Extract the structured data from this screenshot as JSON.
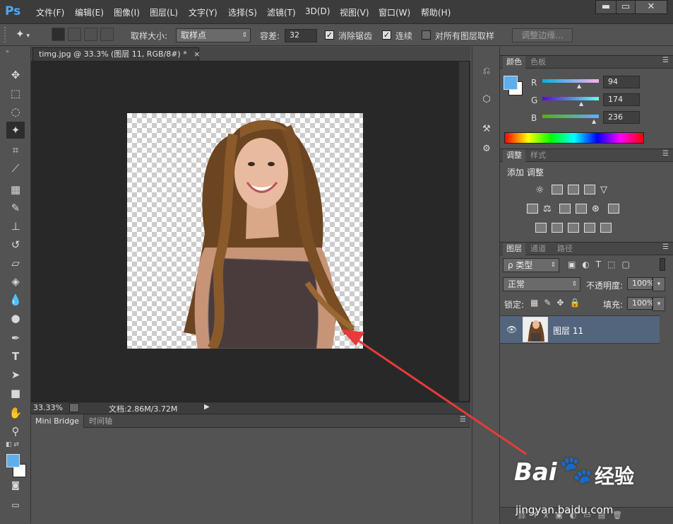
{
  "app": {
    "logo": "Ps"
  },
  "menu": [
    "文件(F)",
    "编辑(E)",
    "图像(I)",
    "图层(L)",
    "文字(Y)",
    "选择(S)",
    "滤镜(T)",
    "3D(D)",
    "视图(V)",
    "窗口(W)",
    "帮助(H)"
  ],
  "window_controls": {
    "minimize": "▬",
    "maximize": "▭",
    "close": "✕"
  },
  "options": {
    "sample_size_label": "取样大小:",
    "sample_size_value": "取样点",
    "tolerance_label": "容差:",
    "tolerance_value": "32",
    "antialias_label": "消除锯齿",
    "antialias_checked": true,
    "contiguous_label": "连续",
    "contiguous_checked": true,
    "all_layers_label": "对所有图层取样",
    "all_layers_checked": false,
    "refine_edge_label": "调整边缘..."
  },
  "document": {
    "tab_title": "timg.jpg @ 33.3% (图层 11, RGB/8#) *",
    "close": "×"
  },
  "status": {
    "zoom": "33.33%",
    "doc_label": "文档:2.86M/3.72M"
  },
  "bridge": {
    "tabs": [
      "Mini Bridge",
      "时间轴"
    ]
  },
  "color_panel": {
    "tabs": [
      "颜色",
      "色板"
    ],
    "r_label": "R",
    "r_value": "94",
    "g_label": "G",
    "g_value": "174",
    "b_label": "B",
    "b_value": "236",
    "fg_color": "#5eaeec",
    "r_frac": 0.37,
    "g_frac": 0.68,
    "b_frac": 0.93
  },
  "adjust_panel": {
    "tabs": [
      "调整",
      "样式"
    ],
    "title": "添加 调整"
  },
  "layers_panel": {
    "tabs": [
      "图层",
      "通道",
      "路径"
    ],
    "filter_label": "ρ 类型",
    "blend_mode": "正常",
    "opacity_label": "不透明度:",
    "opacity_value": "100%",
    "lock_label": "锁定:",
    "fill_label": "填充:",
    "fill_value": "100%",
    "layers": [
      {
        "name": "图层 11"
      }
    ]
  },
  "watermark": {
    "brand": "Bai",
    "brand2": "经验",
    "url": "jingyan.baidu.com"
  },
  "colors": {
    "accent": "#4aa9ff",
    "selected_layer": "#53657d",
    "arrow": "#e83a3a"
  }
}
